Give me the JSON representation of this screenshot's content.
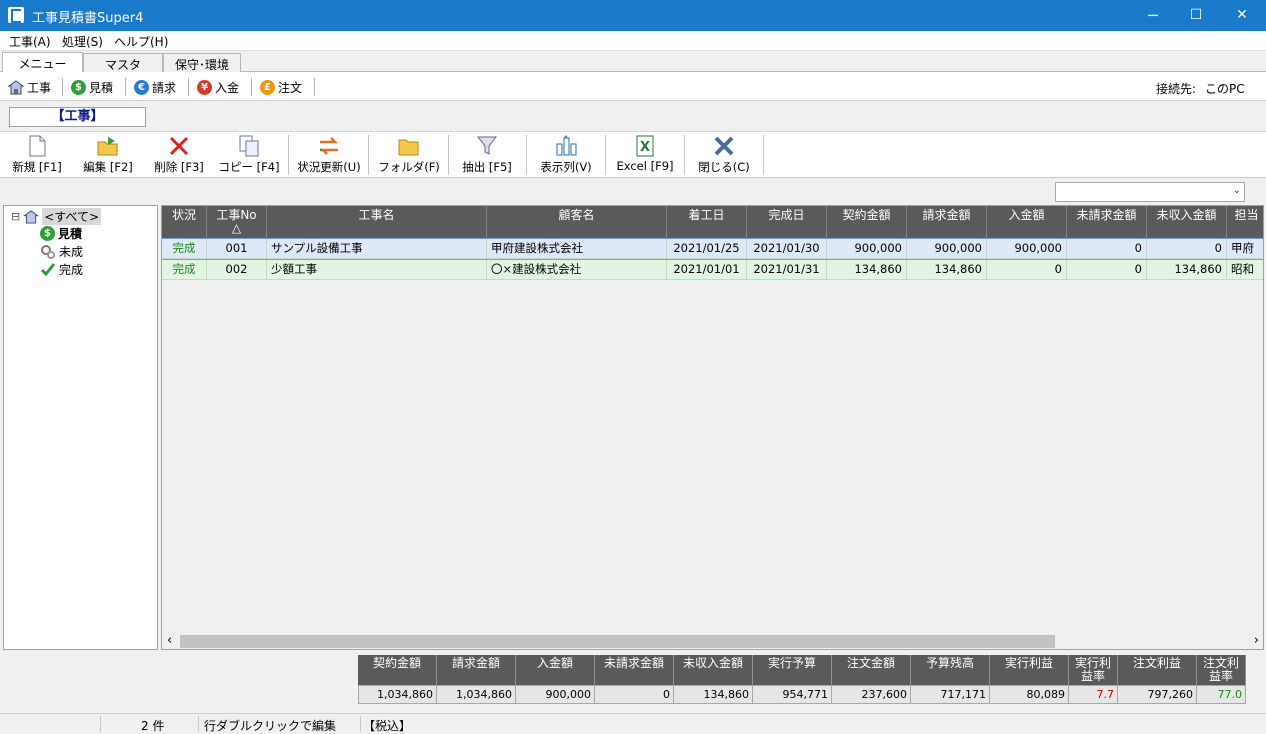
{
  "window": {
    "title": "工事見積書Super4",
    "minimize": "─",
    "maximize": "☐",
    "close": "✕"
  },
  "menu": [
    "工事(A)",
    "処理(S)",
    "ヘルプ(H)"
  ],
  "tabs": [
    "メニュー",
    "マスタ",
    "保守･環境"
  ],
  "nav": {
    "items": [
      {
        "label": "工事",
        "icon": "house-icon"
      },
      {
        "label": "見積",
        "icon": "dollar-coin-icon",
        "color": "#2e9e3a"
      },
      {
        "label": "請求",
        "icon": "euro-coin-icon",
        "color": "#2a7ad0"
      },
      {
        "label": "入金",
        "icon": "yen-coin-icon",
        "color": "#d43a2a"
      },
      {
        "label": "注文",
        "icon": "pound-coin-icon",
        "color": "#e89a10"
      }
    ],
    "connection_label": "接続先:",
    "connection_value": "このPC"
  },
  "mode_label": "【工事】",
  "toolbar": [
    {
      "label": "新規 [F1]",
      "icon": "new-document-icon"
    },
    {
      "label": "編集 [F2]",
      "icon": "edit-folder-icon"
    },
    {
      "label": "削除 [F3]",
      "icon": "delete-x-icon"
    },
    {
      "label": "コピー [F4]",
      "icon": "copy-icon"
    },
    {
      "label": "状況更新(U)",
      "icon": "refresh-arrows-icon"
    },
    {
      "label": "フォルダ(F)",
      "icon": "folder-icon"
    },
    {
      "label": "抽出 [F5]",
      "icon": "filter-funnel-icon"
    },
    {
      "label": "表示列(V)",
      "icon": "columns-icon"
    },
    {
      "label": "Excel [F9]",
      "icon": "excel-icon"
    },
    {
      "label": "閉じる(C)",
      "icon": "close-x-icon"
    }
  ],
  "filter": {
    "value": "",
    "arrow": "⌄"
  },
  "tree": {
    "root": "<すべて>",
    "toggle": "⊟",
    "children": [
      "見積",
      "未成",
      "完成"
    ]
  },
  "grid": {
    "headers": [
      "状況",
      "工事No\n△",
      "工事名",
      "顧客名",
      "着工日",
      "完成日",
      "契約金額",
      "請求金額",
      "入金額",
      "未請求金額",
      "未収入金額",
      "担当"
    ],
    "rows": [
      [
        "完成",
        "001",
        "サンプル設備工事",
        "甲府建設株式会社",
        "2021/01/25",
        "2021/01/30",
        "900,000",
        "900,000",
        "900,000",
        "0",
        "0",
        "甲府"
      ],
      [
        "完成",
        "002",
        "少額工事",
        "〇×建設株式会社",
        "2021/01/01",
        "2021/01/31",
        "134,860",
        "134,860",
        "0",
        "0",
        "134,860",
        "昭和"
      ]
    ],
    "status_color": "#1a8a1a",
    "row_colors": [
      "#dfe8f6",
      "#e2f5e2"
    ]
  },
  "scroll": {
    "left": "‹",
    "right": "›"
  },
  "summary": {
    "headers": [
      "契約金額",
      "請求金額",
      "入金額",
      "未請求金額",
      "未収入金額",
      "実行予算",
      "注文金額",
      "予算残高",
      "実行利益",
      "実行利\n益率",
      "注文利益",
      "注文利\n益率"
    ],
    "values": [
      "1,034,860",
      "1,034,860",
      "900,000",
      "0",
      "134,860",
      "954,771",
      "237,600",
      "717,171",
      "80,089",
      "7.7",
      "797,260",
      "77.0"
    ],
    "value_colors": {
      "9": "#c00000",
      "11": "#1a8a1a"
    }
  },
  "status": {
    "count": "2 件",
    "hint": "行ダブルクリックで編集",
    "tax": "【税込】"
  }
}
